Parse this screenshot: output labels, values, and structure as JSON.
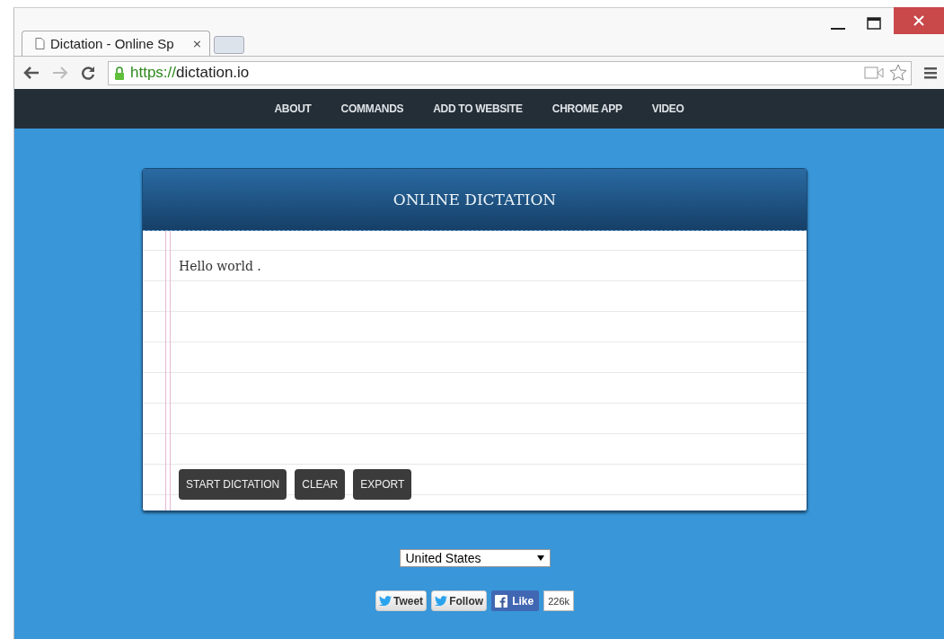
{
  "browser": {
    "tab_title": "Dictation - Online Sp",
    "tab_close": "×",
    "url_scheme": "https://",
    "url_host": "dictation.io"
  },
  "nav": {
    "items": [
      {
        "label": "ABOUT"
      },
      {
        "label": "COMMANDS"
      },
      {
        "label": "ADD TO WEBSITE"
      },
      {
        "label": "CHROME APP"
      },
      {
        "label": "VIDEO"
      }
    ]
  },
  "card": {
    "title": "ONLINE DICTATION",
    "text": "Hello world .",
    "buttons": [
      "START DICTATION",
      "CLEAR",
      "EXPORT"
    ]
  },
  "language_select": {
    "value": "United States"
  },
  "social": {
    "tweet": "Tweet",
    "follow": "Follow",
    "like": "Like",
    "like_count": "226k"
  }
}
